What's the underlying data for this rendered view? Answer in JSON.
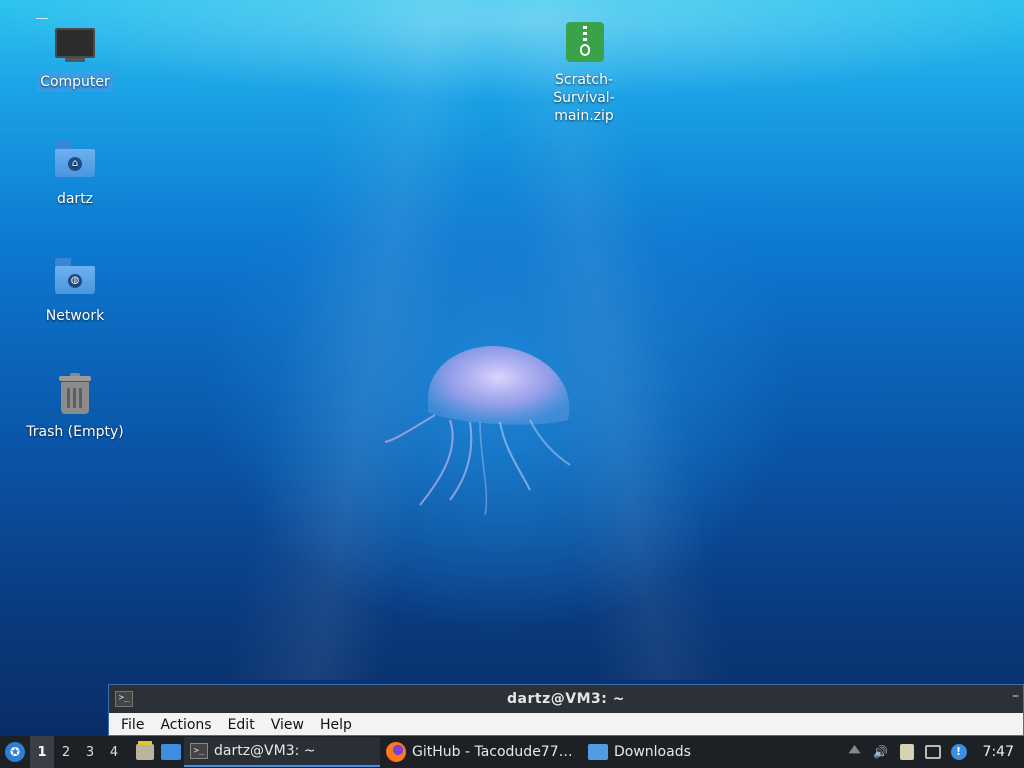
{
  "desktop": {
    "icons": [
      {
        "label": "Computer",
        "icon": "computer-icon",
        "selected": true
      },
      {
        "label": "dartz",
        "icon": "home-folder-icon"
      },
      {
        "label": "Network",
        "icon": "network-folder-icon"
      },
      {
        "label": "Trash (Empty)",
        "icon": "trash-icon"
      },
      {
        "label": "Scratch-Survival-main.zip",
        "label_line1": "Scratch-Survival-",
        "label_line2": "main.zip",
        "icon": "zip-archive-icon"
      }
    ]
  },
  "terminal": {
    "title": "dartz@VM3: ~",
    "icon_glyph": ">_",
    "minimize": "–",
    "menu": [
      "File",
      "Actions",
      "Edit",
      "View",
      "Help"
    ]
  },
  "taskbar": {
    "workspaces": [
      "1",
      "2",
      "3",
      "4"
    ],
    "active_workspace": "1",
    "tasks": [
      {
        "label": "dartz@VM3: ~",
        "icon": "terminal-icon",
        "active": true
      },
      {
        "label": "GitHub - Tacodude77…",
        "icon": "firefox-icon"
      },
      {
        "label": "Downloads",
        "icon": "folder-icon"
      }
    ],
    "clock": "7:47"
  },
  "colors": {
    "taskbar_bg": "#1d2126",
    "accent": "#4a8fdc",
    "terminal_titlebar": "#2c3138"
  }
}
